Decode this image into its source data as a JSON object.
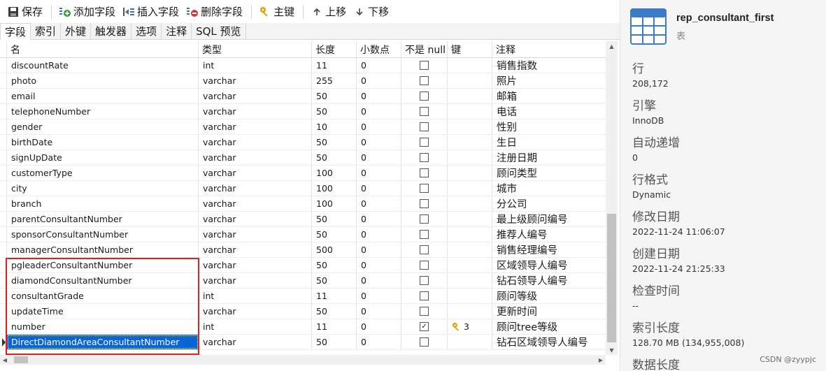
{
  "toolbar": {
    "save": "保存",
    "add_field": "添加字段",
    "insert_field": "插入字段",
    "delete_field": "删除字段",
    "primary_key": "主键",
    "move_up": "上移",
    "move_down": "下移"
  },
  "tabs": [
    "字段",
    "索引",
    "外键",
    "触发器",
    "选项",
    "注释",
    "SQL 预览"
  ],
  "columns": [
    "名",
    "类型",
    "长度",
    "小数点",
    "不是 null",
    "键",
    "注释"
  ],
  "rows": [
    {
      "name": "discountRate",
      "type": "int",
      "length": "11",
      "decimals": "0",
      "not_null": false,
      "key": "",
      "comment": "销售指数"
    },
    {
      "name": "photo",
      "type": "varchar",
      "length": "255",
      "decimals": "0",
      "not_null": false,
      "key": "",
      "comment": "照片"
    },
    {
      "name": "email",
      "type": "varchar",
      "length": "50",
      "decimals": "0",
      "not_null": false,
      "key": "",
      "comment": "邮箱"
    },
    {
      "name": "telephoneNumber",
      "type": "varchar",
      "length": "50",
      "decimals": "0",
      "not_null": false,
      "key": "",
      "comment": "电话"
    },
    {
      "name": "gender",
      "type": "varchar",
      "length": "10",
      "decimals": "0",
      "not_null": false,
      "key": "",
      "comment": "性别"
    },
    {
      "name": "birthDate",
      "type": "varchar",
      "length": "50",
      "decimals": "0",
      "not_null": false,
      "key": "",
      "comment": "生日"
    },
    {
      "name": "signUpDate",
      "type": "varchar",
      "length": "50",
      "decimals": "0",
      "not_null": false,
      "key": "",
      "comment": "注册日期"
    },
    {
      "name": "customerType",
      "type": "varchar",
      "length": "100",
      "decimals": "0",
      "not_null": false,
      "key": "",
      "comment": "顾问类型"
    },
    {
      "name": "city",
      "type": "varchar",
      "length": "100",
      "decimals": "0",
      "not_null": false,
      "key": "",
      "comment": "城市"
    },
    {
      "name": "branch",
      "type": "varchar",
      "length": "100",
      "decimals": "0",
      "not_null": false,
      "key": "",
      "comment": "分公司"
    },
    {
      "name": "parentConsultantNumber",
      "type": "varchar",
      "length": "50",
      "decimals": "0",
      "not_null": false,
      "key": "",
      "comment": "最上级顾问编号"
    },
    {
      "name": "sponsorConsultantNumber",
      "type": "varchar",
      "length": "50",
      "decimals": "0",
      "not_null": false,
      "key": "",
      "comment": "推荐人编号"
    },
    {
      "name": "managerConsultantNumber",
      "type": "varchar",
      "length": "500",
      "decimals": "0",
      "not_null": false,
      "key": "",
      "comment": "销售经理编号"
    },
    {
      "name": "pgleaderConsultantNumber",
      "type": "varchar",
      "length": "50",
      "decimals": "0",
      "not_null": false,
      "key": "",
      "comment": "区域领导人编号"
    },
    {
      "name": "diamondConsultantNumber",
      "type": "varchar",
      "length": "50",
      "decimals": "0",
      "not_null": false,
      "key": "",
      "comment": "钻石领导人编号"
    },
    {
      "name": "consultantGrade",
      "type": "int",
      "length": "11",
      "decimals": "0",
      "not_null": false,
      "key": "",
      "comment": "顾问等级"
    },
    {
      "name": "updateTime",
      "type": "varchar",
      "length": "50",
      "decimals": "0",
      "not_null": false,
      "key": "",
      "comment": "更新时间"
    },
    {
      "name": "number",
      "type": "int",
      "length": "11",
      "decimals": "0",
      "not_null": true,
      "key": "3",
      "comment": "顾问tree等级"
    },
    {
      "name": "DirectDiamondAreaConsultantNumber",
      "type": "varchar",
      "length": "50",
      "decimals": "0",
      "not_null": false,
      "key": "",
      "comment": "钻石区域领导人编号",
      "selected": true
    }
  ],
  "panel": {
    "table_name": "rep_consultant_first",
    "object_type": "表",
    "info": [
      {
        "label": "行",
        "value": "208,172"
      },
      {
        "label": "引擎",
        "value": "InnoDB"
      },
      {
        "label": "自动递增",
        "value": "0"
      },
      {
        "label": "行格式",
        "value": "Dynamic"
      },
      {
        "label": "修改日期",
        "value": "2022-11-24 11:06:07"
      },
      {
        "label": "创建日期",
        "value": "2022-11-24 21:25:33"
      },
      {
        "label": "检查时间",
        "value": "--"
      },
      {
        "label": "索引长度",
        "value": "128.70 MB (134,955,008)"
      },
      {
        "label": "数据长度",
        "value": ""
      }
    ]
  },
  "watermark": "CSDN @zyypjc",
  "colors": {
    "selection": "#0a64d8",
    "highlight": "#e02020",
    "key_icon": "#e0a000"
  }
}
